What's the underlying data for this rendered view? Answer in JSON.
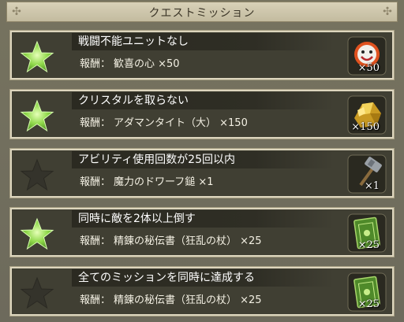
{
  "header": {
    "title": "クエストミッション"
  },
  "reward_label": "報酬：",
  "missions": [
    {
      "name": "戦闘不能ユニットなし",
      "reward": "歓喜の心 ×50",
      "quantity": "×50",
      "achieved": true,
      "icon": "joy-heart-mask-icon"
    },
    {
      "name": "クリスタルを取らない",
      "reward": "アダマンタイト（大） ×150",
      "quantity": "×150",
      "achieved": true,
      "icon": "adamantite-gold-ore-icon"
    },
    {
      "name": "アビリティ使用回数が25回以内",
      "reward": "魔力のドワーフ鎚 ×1",
      "quantity": "×1",
      "achieved": false,
      "icon": "dwarf-hammer-icon"
    },
    {
      "name": "同時に敵を2体以上倒す",
      "reward": "精錬の秘伝書（狂乱の杖） ×25",
      "quantity": "×25",
      "achieved": true,
      "icon": "green-tome-icon"
    },
    {
      "name": "全てのミッションを同時に達成する",
      "reward": "精錬の秘伝書（狂乱の杖） ×25",
      "quantity": "×25",
      "achieved": false,
      "icon": "green-tome-icon"
    }
  ],
  "colors": {
    "star_achieved": "#8fd84a",
    "star_unachieved": "#34332b",
    "panel": "#403f33"
  }
}
